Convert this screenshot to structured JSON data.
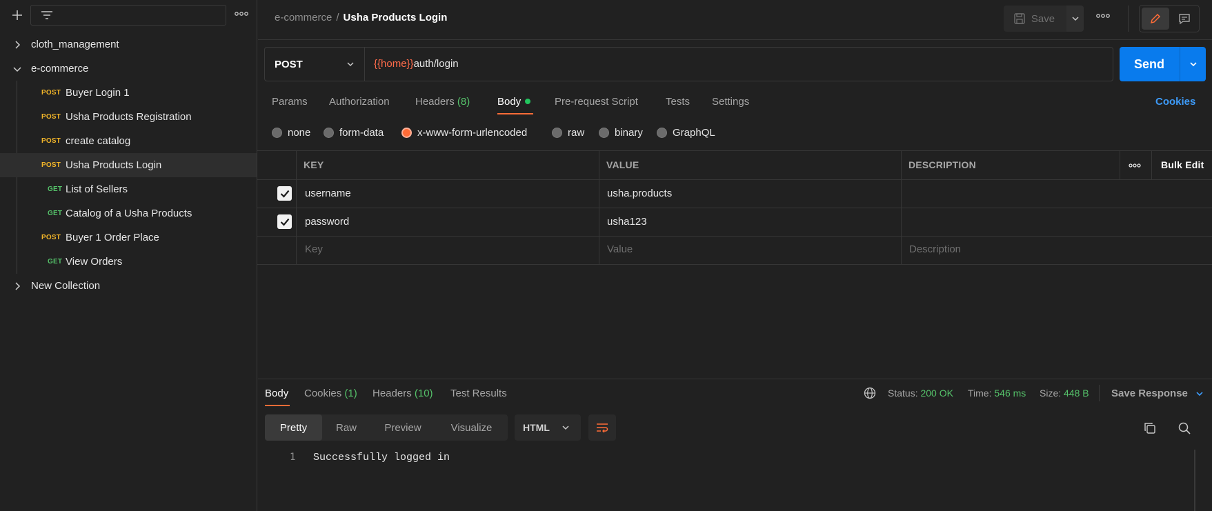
{
  "sidebar": {
    "icons": {
      "add": "plus-icon",
      "filter": "filter-icon",
      "more": "more-horizontal-icon"
    },
    "collections": [
      {
        "name": "cloth_management",
        "expanded": false
      },
      {
        "name": "e-commerce",
        "expanded": true
      },
      {
        "name": "New Collection",
        "expanded": false
      }
    ],
    "requests": [
      {
        "method": "POST",
        "name": "Buyer Login 1"
      },
      {
        "method": "POST",
        "name": "Usha Products Registration"
      },
      {
        "method": "POST",
        "name": "create catalog"
      },
      {
        "method": "POST",
        "name": "Usha Products Login",
        "selected": true
      },
      {
        "method": "GET",
        "name": "List of Sellers"
      },
      {
        "method": "GET",
        "name": "Catalog of a Usha Products"
      },
      {
        "method": "POST",
        "name": "Buyer 1 Order Place"
      },
      {
        "method": "GET",
        "name": "View Orders"
      }
    ]
  },
  "header": {
    "breadcrumb_parent": "e-commerce",
    "breadcrumb_sep": "/",
    "title": "Usha Products Login",
    "save_label": "Save"
  },
  "request": {
    "method": "POST",
    "url_variable": "{{home}}",
    "url_path": "auth/login",
    "send_label": "Send"
  },
  "tabs": {
    "params": "Params",
    "authorization": "Authorization",
    "headers": "Headers",
    "headers_count": "(8)",
    "body": "Body",
    "prerequest": "Pre-request Script",
    "tests": "Tests",
    "settings": "Settings",
    "cookies": "Cookies"
  },
  "body_types": {
    "none": "none",
    "form_data": "form-data",
    "urlencoded": "x-www-form-urlencoded",
    "raw": "raw",
    "binary": "binary",
    "graphql": "GraphQL",
    "selected": "x-www-form-urlencoded"
  },
  "table": {
    "headers": {
      "key": "KEY",
      "value": "VALUE",
      "description": "DESCRIPTION",
      "bulk_edit": "Bulk Edit"
    },
    "rows": [
      {
        "key": "username",
        "value": "usha.products",
        "checked": true
      },
      {
        "key": "password",
        "value": "usha123",
        "checked": true
      }
    ],
    "placeholders": {
      "key": "Key",
      "value": "Value",
      "description": "Description"
    }
  },
  "response": {
    "tabs": {
      "body": "Body",
      "cookies": "Cookies",
      "cookies_count": "(1)",
      "headers": "Headers",
      "headers_count": "(10)",
      "test_results": "Test Results"
    },
    "status_label": "Status:",
    "status_value": "200 OK",
    "time_label": "Time:",
    "time_value": "546 ms",
    "size_label": "Size:",
    "size_value": "448 B",
    "save_response": "Save Response",
    "views": {
      "pretty": "Pretty",
      "raw": "Raw",
      "preview": "Preview",
      "visualize": "Visualize"
    },
    "format": "HTML",
    "line_number": "1",
    "body_text": "Successfully logged in"
  },
  "colors": {
    "accent": "#ff6c37",
    "send": "#097bed",
    "link": "#3d9af7",
    "success": "#55c26a",
    "post": "#f0b429",
    "get": "#55c26a"
  }
}
